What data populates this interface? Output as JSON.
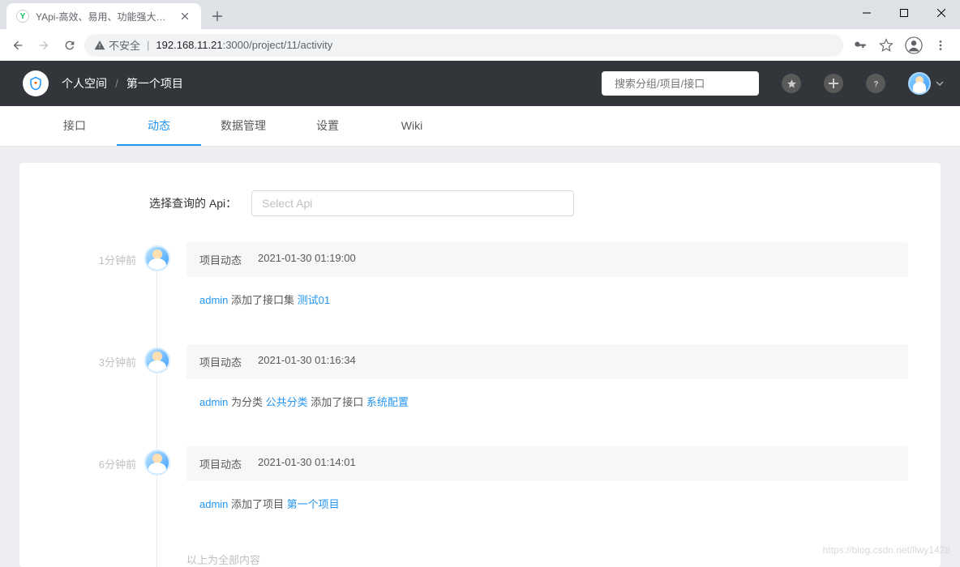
{
  "browser": {
    "tab_title": "YApi-高效、易用、功能强大的可...",
    "security_label": "不安全",
    "url_host": "192.168.11.21",
    "url_port_path": ":3000/project/11/activity"
  },
  "header": {
    "breadcrumb": {
      "space": "个人空间",
      "project": "第一个项目"
    },
    "search_placeholder": "搜索分组/项目/接口"
  },
  "tabs": [
    {
      "key": "api",
      "label": "接口",
      "active": false
    },
    {
      "key": "activity",
      "label": "动态",
      "active": true
    },
    {
      "key": "data",
      "label": "数据管理",
      "active": false
    },
    {
      "key": "setting",
      "label": "设置",
      "active": false
    },
    {
      "key": "wiki",
      "label": "Wiki",
      "active": false
    }
  ],
  "filter": {
    "label": "选择查询的 Api：",
    "placeholder": "Select Api"
  },
  "timeline": {
    "title_label": "项目动态",
    "items": [
      {
        "rel_time": "1分钟前",
        "timestamp": "2021-01-30 01:19:00",
        "parts": [
          {
            "t": "link",
            "v": "admin"
          },
          {
            "t": "text",
            "v": " 添加了接口集 "
          },
          {
            "t": "link",
            "v": "测试01"
          }
        ]
      },
      {
        "rel_time": "3分钟前",
        "timestamp": "2021-01-30 01:16:34",
        "parts": [
          {
            "t": "link",
            "v": "admin"
          },
          {
            "t": "text",
            "v": " 为分类 "
          },
          {
            "t": "link",
            "v": "公共分类"
          },
          {
            "t": "text",
            "v": " 添加了接口 "
          },
          {
            "t": "link",
            "v": "系统配置"
          }
        ]
      },
      {
        "rel_time": "6分钟前",
        "timestamp": "2021-01-30 01:14:01",
        "parts": [
          {
            "t": "link",
            "v": "admin"
          },
          {
            "t": "text",
            "v": " 添加了项目 "
          },
          {
            "t": "link",
            "v": "第一个项目"
          }
        ]
      }
    ],
    "end_text": "以上为全部内容"
  },
  "watermark": "https://blog.csdn.net/llwy1428"
}
